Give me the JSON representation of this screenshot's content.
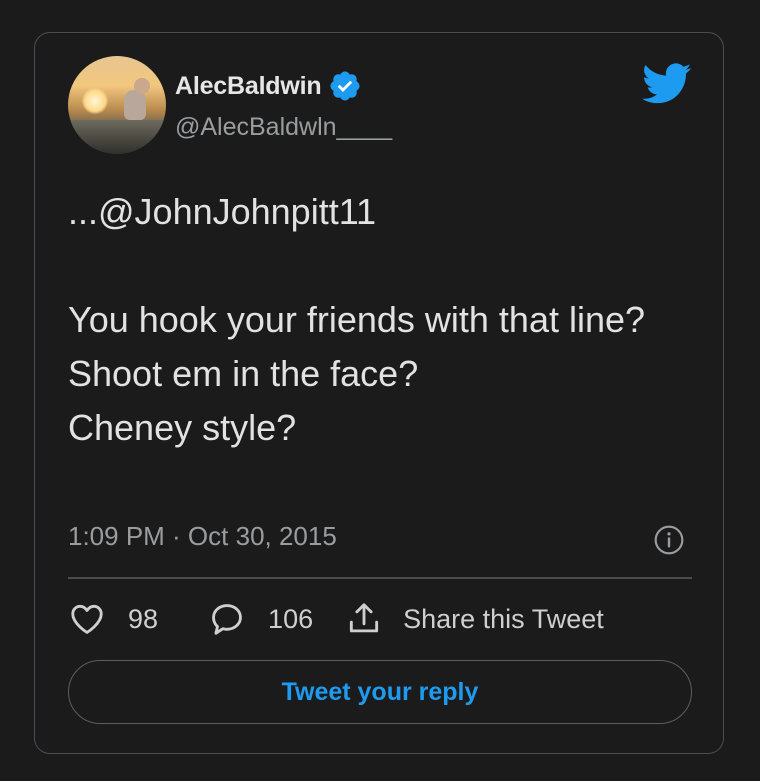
{
  "user": {
    "display_name": "AlecBaldwin",
    "handle": "@AlecBaldwln____",
    "verified_icon": "verified-badge-icon",
    "avatar_icon": "profile-photo"
  },
  "brand": {
    "icon": "twitter-bird-icon",
    "color": "#1d9bf0"
  },
  "tweet": {
    "lines": [
      "...@JohnJohnpitt11",
      "",
      "You hook your friends with that line?",
      "Shoot em in the face?",
      "Cheney style?"
    ],
    "timestamp": "1:09 PM · Oct 30, 2015",
    "info_icon": "info-icon"
  },
  "actions": {
    "likes": {
      "icon": "heart-icon",
      "count": "98"
    },
    "replies": {
      "icon": "reply-bubble-icon",
      "count": "106"
    },
    "share": {
      "icon": "share-icon",
      "label": "Share this Tweet"
    }
  },
  "reply_button": {
    "label": "Tweet your reply"
  },
  "colors": {
    "background": "#1b1b1c",
    "border": "#4a4e52",
    "text": "#e2e2e2",
    "secondary_text": "#9a9da0",
    "accent": "#1d9bf0"
  }
}
